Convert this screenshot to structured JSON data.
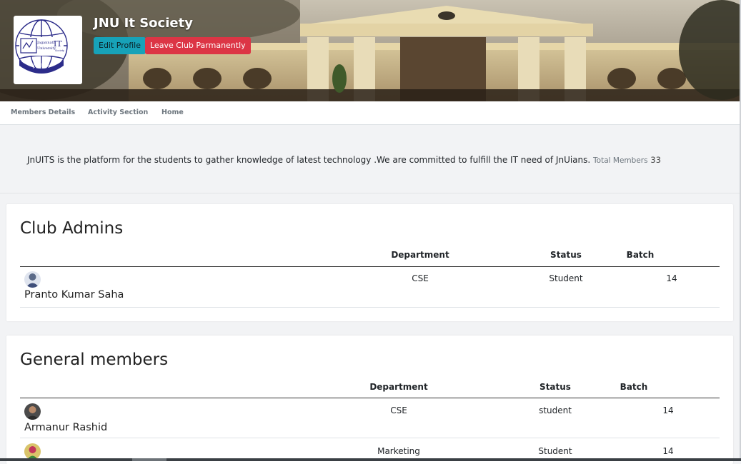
{
  "header": {
    "club_name": "JNU It Society",
    "edit_button": "Edit Profile",
    "leave_button": "Leave Club Parmanently",
    "logo": {
      "top_text": "Jagannath",
      "mid_text": "University",
      "right_text": "IT",
      "right_small": "Society",
      "bottom_text": "JNUITS"
    }
  },
  "nav": {
    "items": [
      "Members Details",
      "Activity Section",
      "Home"
    ]
  },
  "description": {
    "text": "JnUITS is the platform for the students to gather knowledge of latest technology .We are committed to fulfill the IT need of JnUians.",
    "total_label": "Total Members",
    "total_value": "33"
  },
  "admins": {
    "title": "Club Admins",
    "columns": [
      "Department",
      "Status",
      "Batch"
    ],
    "rows": [
      {
        "name": "Pranto Kumar Saha",
        "department": "CSE",
        "status": "Student",
        "batch": "14"
      }
    ]
  },
  "members": {
    "title": "General members",
    "columns": [
      "Department",
      "Status",
      "Batch"
    ],
    "rows": [
      {
        "name": "Armanur Rashid",
        "department": "CSE",
        "status": "student",
        "batch": "14"
      },
      {
        "name": "",
        "department": "Marketing",
        "status": "Student",
        "batch": "14"
      }
    ]
  },
  "colors": {
    "edit_button": "#17a2b8",
    "leave_button": "#dc3545",
    "logo_blue": "#2c2c8a"
  }
}
